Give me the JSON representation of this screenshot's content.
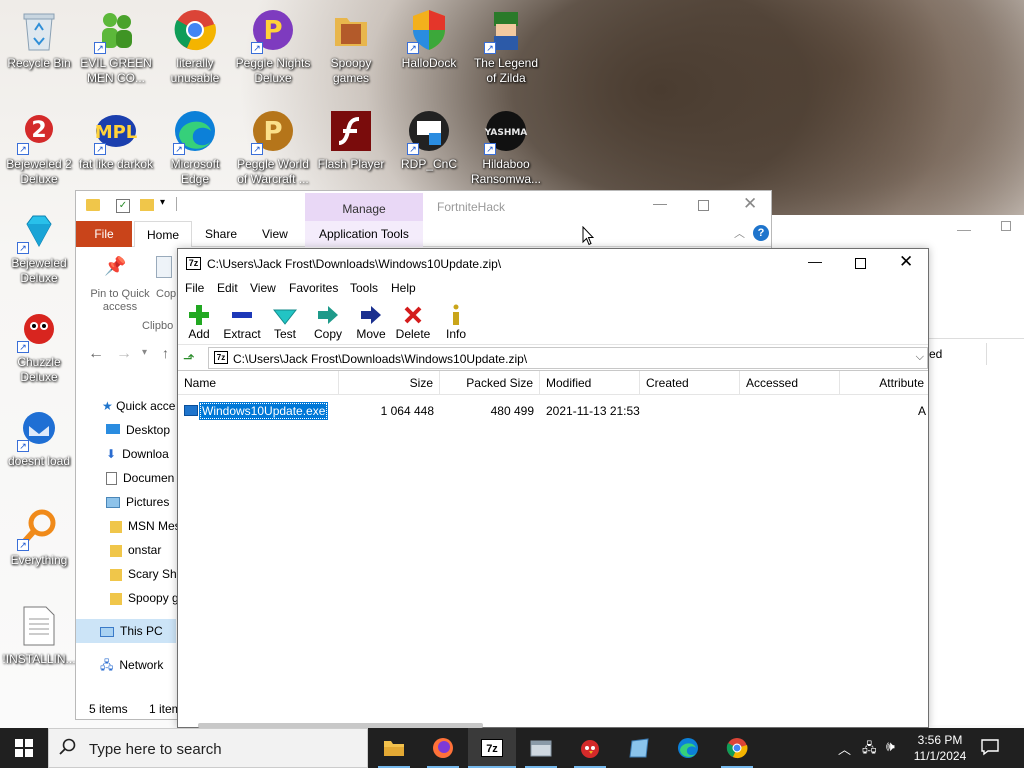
{
  "desktop_icons": [
    {
      "label": "Recycle Bin",
      "icon": "recycle-bin-icon"
    },
    {
      "label": "EVIL GREEN MEN CO...",
      "icon": "green-men-icon"
    },
    {
      "label": "literally unusable",
      "icon": "chrome-icon"
    },
    {
      "label": "Peggle Nights Deluxe",
      "icon": "peggle-icon"
    },
    {
      "label": "Spoopy games",
      "icon": "folder-icon"
    },
    {
      "label": "HalloDock",
      "icon": "shield-icon"
    },
    {
      "label": "The Legend of Zilda",
      "icon": "zilda-icon"
    },
    {
      "label": "Bejeweled 2 Deluxe",
      "icon": "bejeweled-2-icon"
    },
    {
      "label": "fat like darkok",
      "icon": "mpl-icon"
    },
    {
      "label": "Microsoft Edge",
      "icon": "edge-icon"
    },
    {
      "label": "Peggle World of Warcraft ...",
      "icon": "peggle-icon"
    },
    {
      "label": "Flash Player",
      "icon": "flash-icon"
    },
    {
      "label": "RDP_CnC",
      "icon": "rdp-icon"
    },
    {
      "label": "Hildaboo Ransomwa...",
      "icon": "yashma-icon"
    },
    {
      "label": "Bejeweled Deluxe",
      "icon": "gem-icon"
    },
    {
      "label": "Chuzzle Deluxe",
      "icon": "chuzzle-icon"
    },
    {
      "label": "doesnt load",
      "icon": "thunderbird-icon"
    },
    {
      "label": "Everything",
      "icon": "search-icon"
    },
    {
      "label": "!INSTALLIN...",
      "icon": "text-file-icon"
    }
  ],
  "yashma_text": "YASHMA",
  "mpl_text": "MPL",
  "explorer": {
    "tab_label": "FortniteHack",
    "manage_label": "Manage",
    "tabs": [
      "File",
      "Home",
      "Share",
      "View",
      "Application Tools"
    ],
    "pin_label": "Pin to Quick access",
    "copy_label": "Cop",
    "clipboard_label": "Clipbo",
    "nav_items": [
      "Quick acce",
      "Desktop",
      "Downloa",
      "Documen",
      "Pictures",
      "MSN Mes",
      "onstar",
      "Scary Shi",
      "Spoopy g",
      "This PC",
      "Network"
    ],
    "status_items": "5 items",
    "status_selected": "1 item"
  },
  "backwin": {
    "col_label": "ed"
  },
  "sevenzip": {
    "title": "C:\\Users\\Jack Frost\\Downloads\\Windows10Update.zip\\",
    "menu": [
      "File",
      "Edit",
      "View",
      "Favorites",
      "Tools",
      "Help"
    ],
    "toolbar": [
      "Add",
      "Extract",
      "Test",
      "Copy",
      "Move",
      "Delete",
      "Info"
    ],
    "address": "C:\\Users\\Jack Frost\\Downloads\\Windows10Update.zip\\",
    "columns": [
      "Name",
      "Size",
      "Packed Size",
      "Modified",
      "Created",
      "Accessed",
      "Attribute"
    ],
    "rows": [
      {
        "name": "Windows10Update.exe",
        "size": "1 064 448",
        "packed": "480 499",
        "modified": "2021-11-13 21:53",
        "created": "",
        "accessed": "",
        "attr": "A"
      }
    ]
  },
  "taskbar": {
    "search_placeholder": "Type here to search",
    "time": "3:56 PM",
    "date": "11/1/2024",
    "sevenzip_label": "7z"
  },
  "colors": {
    "accent": "#0078d7",
    "file_tab": "#c9441a",
    "selection": "#0078d7",
    "manage": "#e9d8f6"
  }
}
